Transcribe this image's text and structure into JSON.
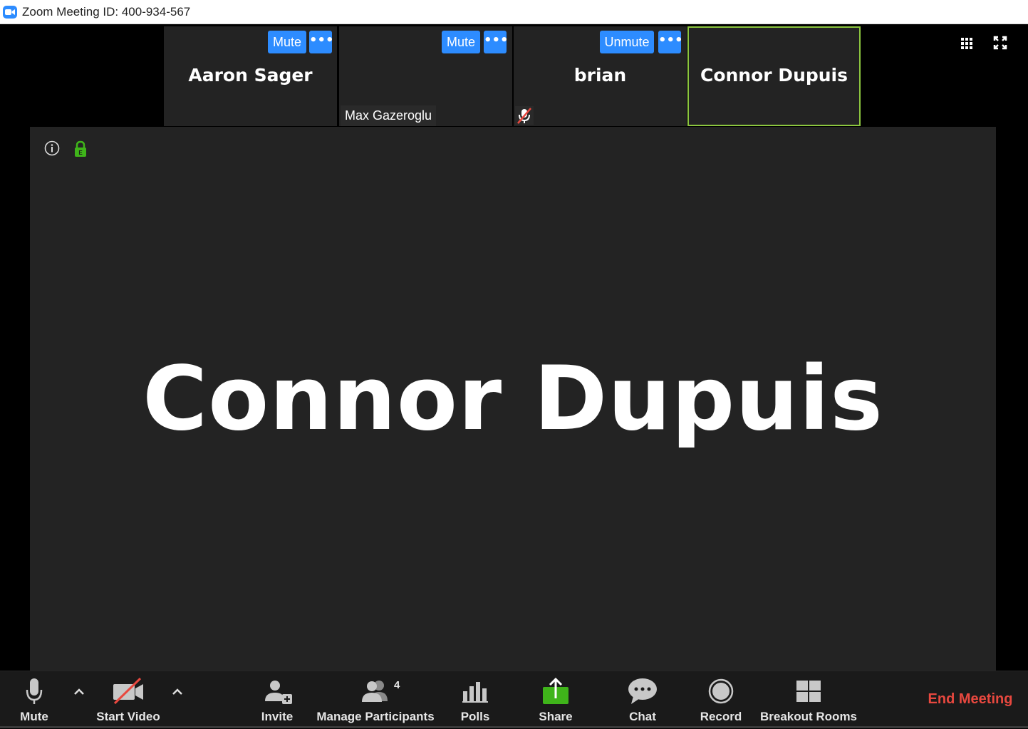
{
  "window": {
    "title": "Zoom Meeting ID: 400-934-567",
    "app_icon": "zoom-camera-icon"
  },
  "tiles": [
    {
      "name": "Aaron Sager",
      "button": "Mute",
      "more": "•••"
    },
    {
      "name_tag": "Max Gazeroglu",
      "button": "Mute",
      "more": "•••"
    },
    {
      "name": "brian",
      "button": "Unmute",
      "more": "•••",
      "muted": true
    },
    {
      "name": "Connor Dupuis",
      "active_speaker": true
    }
  ],
  "view_controls": {
    "gallery_icon": "grid-icon",
    "fullscreen_icon": "fullscreen-icon"
  },
  "main_video": {
    "speaker_name": "Connor Dupuis",
    "info_icon": "info-icon",
    "encryption_icon": "lock-icon"
  },
  "toolbar": {
    "mute": "Mute",
    "start_video": "Start Video",
    "invite": "Invite",
    "manage_participants": "Manage Participants",
    "participant_count": "4",
    "polls": "Polls",
    "share": "Share",
    "chat": "Chat",
    "record": "Record",
    "breakout_rooms": "Breakout Rooms",
    "end_meeting": "End Meeting"
  },
  "colors": {
    "accent_blue": "#2d8cff",
    "active_speaker_border": "#8cc63f",
    "share_green": "#3fb41a",
    "end_meeting_red": "#e8483f",
    "tile_bg": "#232323"
  }
}
